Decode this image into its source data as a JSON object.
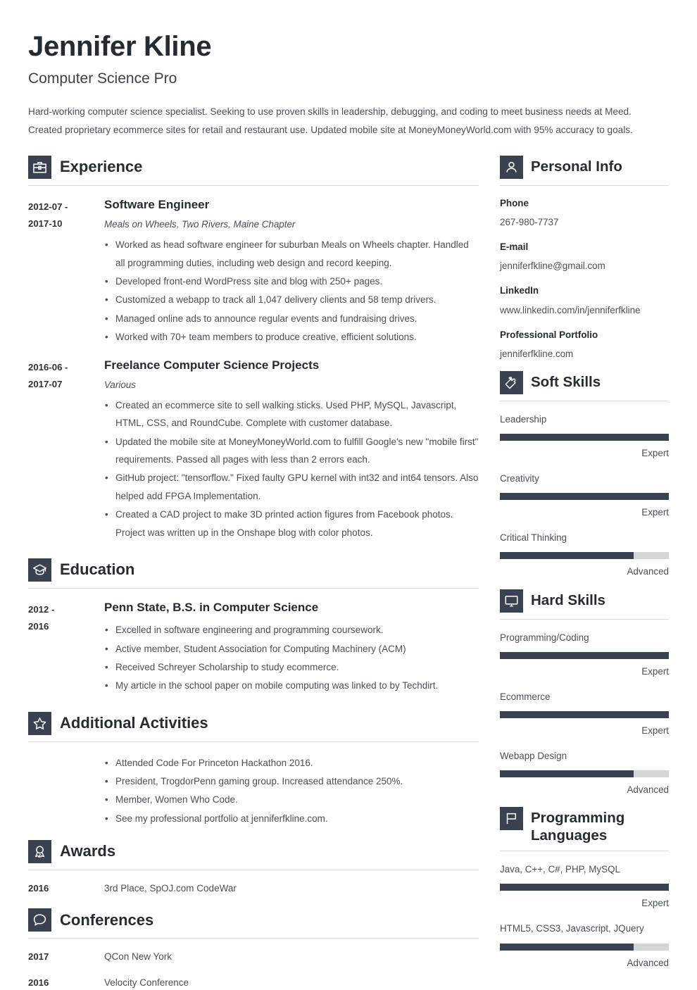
{
  "theme": {
    "dark": "#3a4150",
    "text": "#4a4f58",
    "heading": "#262b34",
    "rule": "#dcdcdc",
    "bar_track": "#d4d6d6",
    "background": "#ffffff"
  },
  "header": {
    "name": "Jennifer Kline",
    "title": "Computer Science Pro",
    "summary": "Hard-working computer science specialist. Seeking to use proven skills in leadership, debugging, and coding to meet business needs at Meed. Created proprietary ecommerce sites for retail and restaurant use. Updated mobile site at MoneyMoneyWorld.com with 95% accuracy to goals."
  },
  "experience": {
    "heading": "Experience",
    "icon": "briefcase-icon",
    "entries": [
      {
        "dates": "2012-07 - 2017-10",
        "dates_line1": "2012-07 -",
        "dates_line2": "2017-10",
        "role": "Software Engineer",
        "org": "Meals on Wheels, Two Rivers, Maine Chapter",
        "bullets": [
          "Worked as head software engineer for suburban Meals on Wheels chapter. Handled all programming duties, including web design and record keeping.",
          "Developed front-end WordPress site and blog with 250+ pages.",
          "Customized a webapp to track all 1,047 delivery clients and 58 temp drivers.",
          "Managed online ads to announce regular events and fundraising drives.",
          "Worked with 70+ team members to produce creative, efficient solutions."
        ]
      },
      {
        "dates": "2016-06 - 2017-07",
        "dates_line1": "2016-06 -",
        "dates_line2": "2017-07",
        "role": "Freelance Computer Science Projects",
        "org": "Various",
        "bullets": [
          "Created an ecommerce site to sell walking sticks. Used PHP, MySQL, Javascript, HTML, CSS, and RoundCube. Complete with customer database.",
          "Updated the mobile site at MoneyMoneyWorld.com to fulfill Google's new \"mobile first\" requirements. Passed all pages with less than 2 errors each.",
          "GitHub project: \"tensorflow.\" Fixed faulty GPU kernel with int32 and int64 tensors. Also helped add FPGA Implementation.",
          "Created a CAD project to make 3D printed action figures from Facebook photos. Project was written up in the Onshape blog with color photos."
        ]
      }
    ]
  },
  "education": {
    "heading": "Education",
    "icon": "graduation-cap-icon",
    "entries": [
      {
        "dates_line1": "2012 -",
        "dates_line2": "2016",
        "degree": "Penn State, B.S. in Computer Science",
        "bullets": [
          "Excelled in software engineering and programming coursework.",
          "Active member, Student Association for Computing Machinery (ACM)",
          "Received Schreyer Scholarship to study ecommerce.",
          "My article in the school paper on mobile computing was linked to by Techdirt."
        ]
      }
    ]
  },
  "additional_activities": {
    "heading": "Additional Activities",
    "icon": "star-icon",
    "bullets": [
      "Attended Code For Princeton Hackathon 2016.",
      "President, TrogdorPenn gaming group. Increased attendance 250%.",
      "Member, Women Who Code.",
      "See my professional portfolio at jenniferfkline.com."
    ]
  },
  "awards": {
    "heading": "Awards",
    "icon": "award-ribbon-icon",
    "items": [
      {
        "year": "2016",
        "text": "3rd Place, SpOJ.com CodeWar"
      }
    ]
  },
  "conferences": {
    "heading": "Conferences",
    "icon": "speech-bubble-icon",
    "items": [
      {
        "year": "2017",
        "text": "QCon New York"
      },
      {
        "year": "2016",
        "text": "Velocity Conference"
      }
    ]
  },
  "personal_info": {
    "heading": "Personal Info",
    "icon": "person-icon",
    "fields": [
      {
        "label": "Phone",
        "value": "267-980-7737"
      },
      {
        "label": "E-mail",
        "value": "jenniferfkline@gmail.com"
      },
      {
        "label": "LinkedIn",
        "value": "www.linkedin.com/in/jenniferfkline"
      },
      {
        "label": "Professional Portfolio",
        "value": "jenniferfkline.com"
      }
    ]
  },
  "soft_skills": {
    "heading": "Soft Skills",
    "icon": "puzzle-piece-icon",
    "skills": [
      {
        "name": "Leadership",
        "level": "Expert",
        "percent": 100
      },
      {
        "name": "Creativity",
        "level": "Expert",
        "percent": 100
      },
      {
        "name": "Critical Thinking",
        "level": "Advanced",
        "percent": 79
      }
    ]
  },
  "hard_skills": {
    "heading": "Hard Skills",
    "icon": "monitor-icon",
    "skills": [
      {
        "name": "Programming/Coding",
        "level": "Expert",
        "percent": 100
      },
      {
        "name": "Ecommerce",
        "level": "Expert",
        "percent": 100
      },
      {
        "name": "Webapp Design",
        "level": "Advanced",
        "percent": 79
      }
    ]
  },
  "programming_languages": {
    "heading": "Programming Languages",
    "heading_line1": "Programming",
    "heading_line2": "Languages",
    "icon": "flag-icon",
    "skills": [
      {
        "name": "Java, C++, C#, PHP, MySQL",
        "level": "Expert",
        "percent": 100
      },
      {
        "name": "HTML5, CSS3, Javascript, JQuery",
        "level": "Advanced",
        "percent": 79
      }
    ]
  }
}
